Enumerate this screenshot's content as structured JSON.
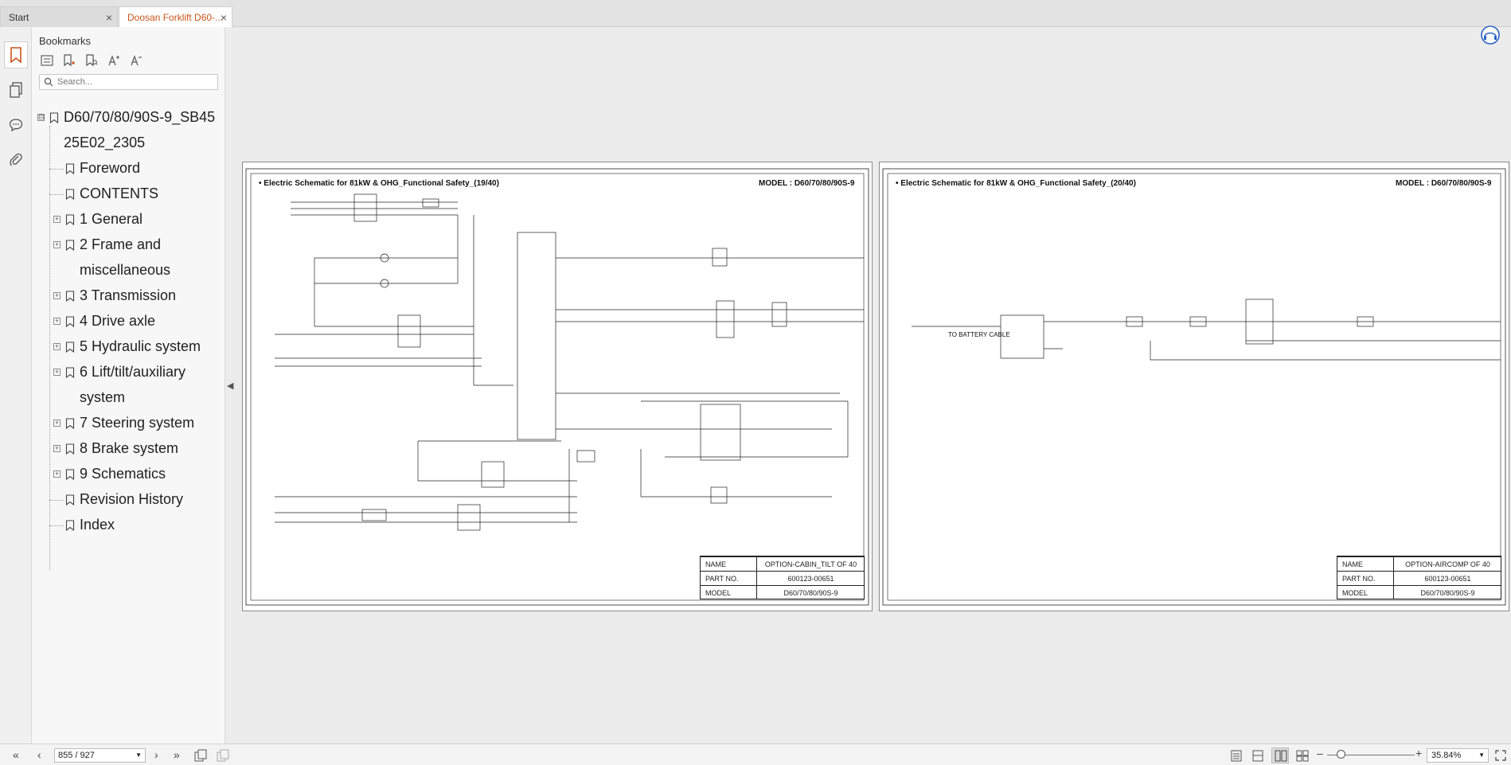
{
  "tabs": [
    {
      "label": "Start",
      "close": "×"
    },
    {
      "label": "Doosan Forklift D60-...",
      "close": "×"
    }
  ],
  "sidebar": {
    "title": "Bookmarks",
    "search_placeholder": "Search...",
    "tree": [
      {
        "label": "D60/70/80/90S-9_SB45",
        "label2": "25E02_2305",
        "expander": "⊟",
        "level": 0
      },
      {
        "label": "Foreword",
        "level": 1
      },
      {
        "label": "CONTENTS",
        "level": 1
      },
      {
        "label": "1 General",
        "expander": "+",
        "level": 1
      },
      {
        "label": "2 Frame and",
        "label2": "miscellaneous",
        "expander": "+",
        "level": 1
      },
      {
        "label": "3 Transmission",
        "expander": "+",
        "level": 1
      },
      {
        "label": "4 Drive axle",
        "expander": "+",
        "level": 1
      },
      {
        "label": "5 Hydraulic system",
        "expander": "+",
        "level": 1
      },
      {
        "label": "6 Lift/tilt/auxiliary",
        "label2": "system",
        "expander": "+",
        "level": 1
      },
      {
        "label": "7 Steering system",
        "expander": "+",
        "level": 1
      },
      {
        "label": "8 Brake system",
        "expander": "+",
        "level": 1
      },
      {
        "label": "9 Schematics",
        "expander": "+",
        "level": 1
      },
      {
        "label": "Revision History",
        "level": 1
      },
      {
        "label": "Index",
        "level": 1
      }
    ]
  },
  "pages": [
    {
      "title": "• Electric Schematic for 81kW & OHG_Functional Safety_(19/40)",
      "model_header": "MODEL : D60/70/80/90S-9",
      "block": [
        {
          "key": "NAME",
          "value": "OPTION-CABIN_TILT OF 40"
        },
        {
          "key": "PART NO.",
          "value": "600123-00651"
        },
        {
          "key": "MODEL",
          "value": "D60/70/80/90S-9"
        }
      ]
    },
    {
      "title": "• Electric Schematic for 81kW & OHG_Functional Safety_(20/40)",
      "model_header": "MODEL : D60/70/80/90S-9",
      "note": "TO BATTERY CABLE",
      "block": [
        {
          "key": "NAME",
          "value": "OPTION-AIRCOMP OF 40"
        },
        {
          "key": "PART NO.",
          "value": "600123-00651"
        },
        {
          "key": "MODEL",
          "value": "D60/70/80/90S-9"
        }
      ]
    }
  ],
  "status": {
    "page_indicator": "855 / 927",
    "zoom": "35.84%",
    "first": "«",
    "prev": "‹",
    "next": "›",
    "last": "»",
    "zoom_out": "–",
    "zoom_in": "+"
  },
  "colors": {
    "accent": "#c8551b",
    "panel": "#f7f7f7",
    "canvas": "#ececec"
  }
}
